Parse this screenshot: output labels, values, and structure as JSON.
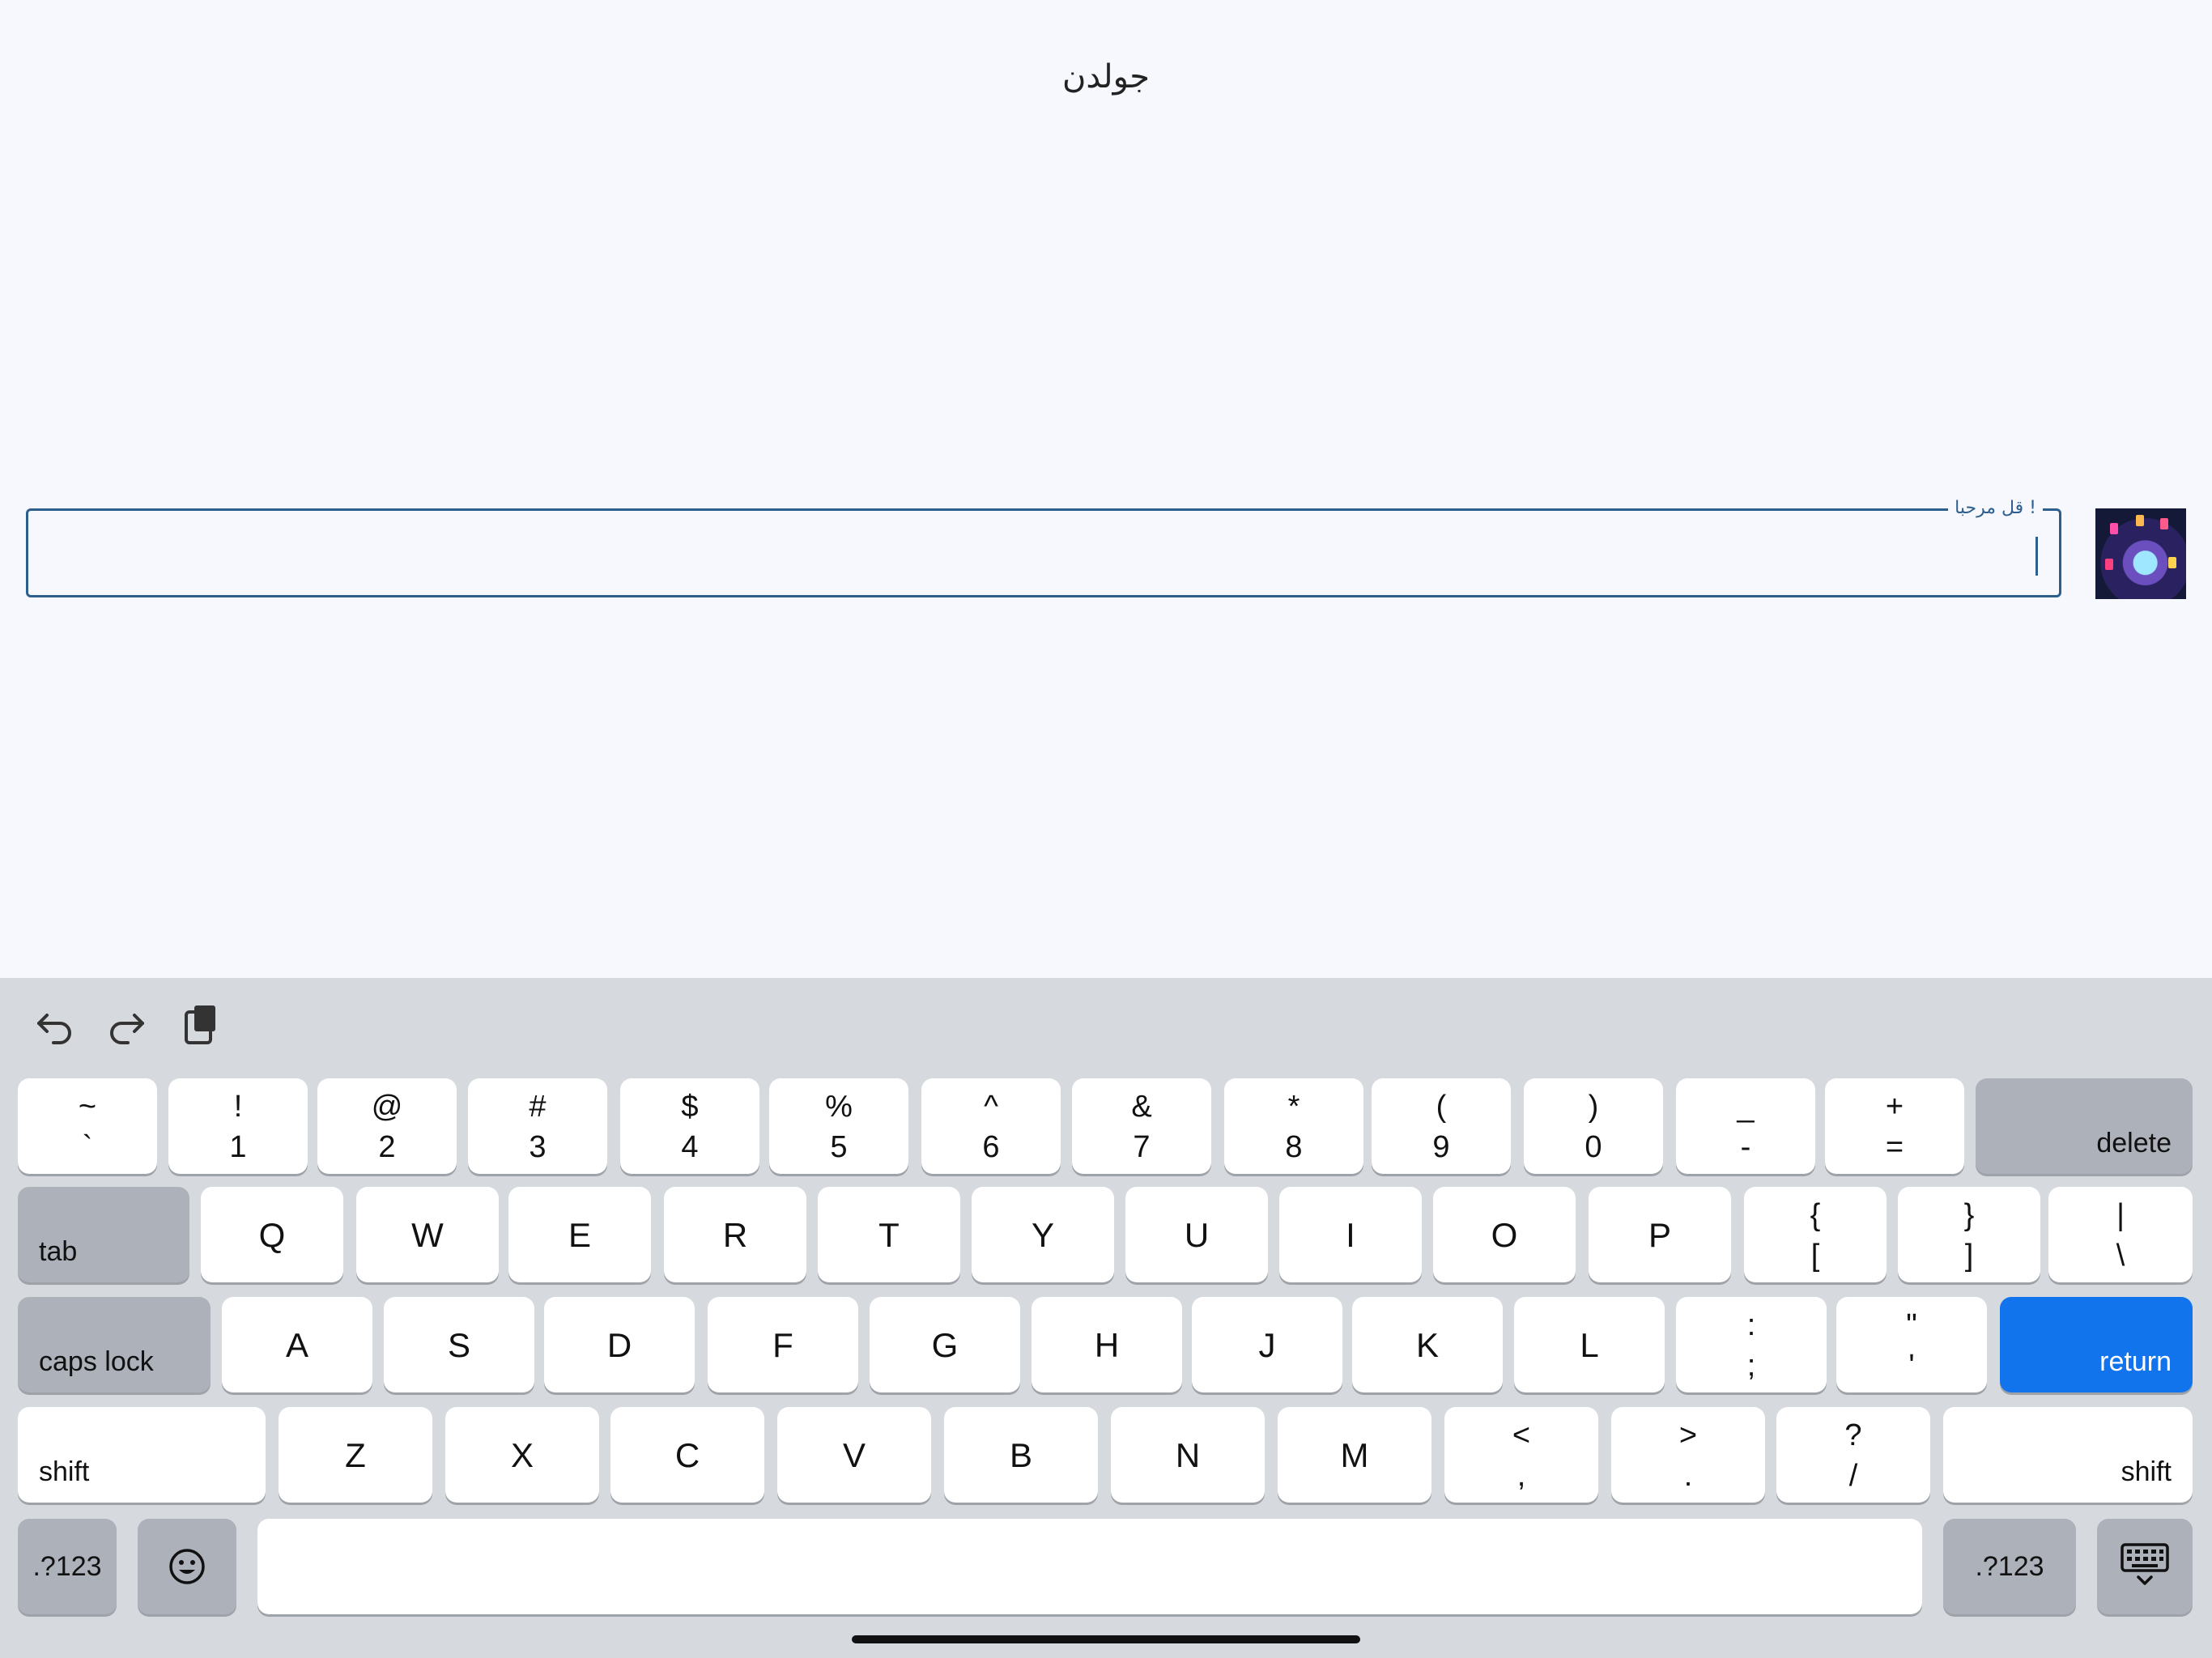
{
  "header": {
    "title": "جولدن"
  },
  "composer": {
    "label": "! قل مرحبا",
    "value": ""
  },
  "keyboard": {
    "toolbar": [
      "undo-icon",
      "redo-icon",
      "paste-icon"
    ],
    "row1": [
      {
        "top": "~",
        "bottom": "`"
      },
      {
        "top": "!",
        "bottom": "1"
      },
      {
        "top": "@",
        "bottom": "2"
      },
      {
        "top": "#",
        "bottom": "3"
      },
      {
        "top": "$",
        "bottom": "4"
      },
      {
        "top": "%",
        "bottom": "5"
      },
      {
        "top": "^",
        "bottom": "6"
      },
      {
        "top": "&",
        "bottom": "7"
      },
      {
        "top": "*",
        "bottom": "8"
      },
      {
        "top": "(",
        "bottom": "9"
      },
      {
        "top": ")",
        "bottom": "0"
      },
      {
        "top": "_",
        "bottom": "-"
      },
      {
        "top": "+",
        "bottom": "="
      }
    ],
    "delete": "delete",
    "tab": "tab",
    "row2": [
      "Q",
      "W",
      "E",
      "R",
      "T",
      "Y",
      "U",
      "I",
      "O",
      "P"
    ],
    "row2_symbols": [
      {
        "top": "{",
        "bottom": "["
      },
      {
        "top": "}",
        "bottom": "]"
      },
      {
        "top": "|",
        "bottom": "\\"
      }
    ],
    "caps": "caps lock",
    "row3": [
      "A",
      "S",
      "D",
      "F",
      "G",
      "H",
      "J",
      "K",
      "L"
    ],
    "row3_symbols": [
      {
        "top": ":",
        "bottom": ";"
      },
      {
        "top": "\"",
        "bottom": "'"
      }
    ],
    "return": "return",
    "shift": "shift",
    "row4": [
      "Z",
      "X",
      "C",
      "V",
      "B",
      "N",
      "M"
    ],
    "row4_symbols": [
      {
        "top": "<",
        "bottom": ","
      },
      {
        "top": ">",
        "bottom": "."
      },
      {
        "top": "?",
        "bottom": "/"
      }
    ],
    "numbers_key": ".?123",
    "emoji_icon": "emoji-icon",
    "dismiss_icon": "keyboard-dismiss-icon"
  }
}
